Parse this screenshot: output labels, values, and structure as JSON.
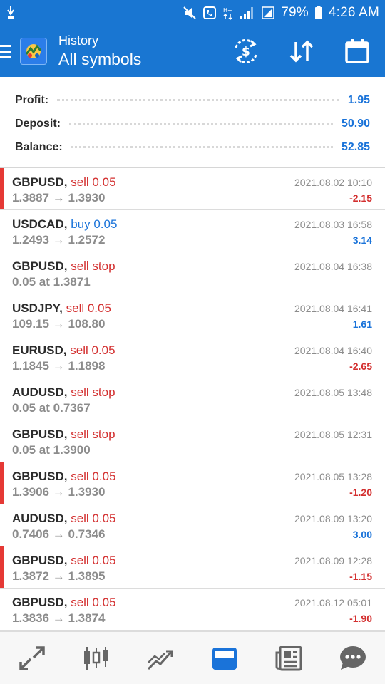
{
  "status_bar": {
    "battery": "79%",
    "time": "4:26 AM",
    "icons": [
      "notification-icon",
      "mute-icon",
      "phone-icon",
      "hplus-icon",
      "signal-icon",
      "battery-icon"
    ]
  },
  "app_bar": {
    "title": "History",
    "subtitle": "All symbols",
    "icons": [
      "menu-icon",
      "app-logo",
      "currency-exchange-icon",
      "sort-icon",
      "calendar-icon"
    ]
  },
  "summary": {
    "profit_label": "Profit:",
    "profit_value": "1.95",
    "deposit_label": "Deposit:",
    "deposit_value": "50.90",
    "balance_label": "Balance:",
    "balance_value": "52.85"
  },
  "trades": [
    {
      "symbol": "GBPUSD,",
      "action": "sell 0.05",
      "type": "sell",
      "detail": "1.3887 → 1.3930",
      "time": "2021.08.02 10:10",
      "profit": "-2.15",
      "marked": true
    },
    {
      "symbol": "USDCAD,",
      "action": "buy 0.05",
      "type": "buy",
      "detail": "1.2493 → 1.2572",
      "time": "2021.08.03 16:58",
      "profit": "3.14",
      "marked": false
    },
    {
      "symbol": "GBPUSD,",
      "action": "sell stop",
      "type": "sell",
      "detail": "0.05 at 1.3871",
      "time": "2021.08.04 16:38",
      "profit": "",
      "marked": false
    },
    {
      "symbol": "USDJPY,",
      "action": "sell 0.05",
      "type": "sell",
      "detail": "109.15 → 108.80",
      "time": "2021.08.04 16:41",
      "profit": "1.61",
      "marked": false
    },
    {
      "symbol": "EURUSD,",
      "action": "sell 0.05",
      "type": "sell",
      "detail": "1.1845 → 1.1898",
      "time": "2021.08.04 16:40",
      "profit": "-2.65",
      "marked": false
    },
    {
      "symbol": "AUDUSD,",
      "action": "sell stop",
      "type": "sell",
      "detail": "0.05 at 0.7367",
      "time": "2021.08.05 13:48",
      "profit": "",
      "marked": false
    },
    {
      "symbol": "GBPUSD,",
      "action": "sell stop",
      "type": "sell",
      "detail": "0.05 at 1.3900",
      "time": "2021.08.05 12:31",
      "profit": "",
      "marked": false
    },
    {
      "symbol": "GBPUSD,",
      "action": "sell 0.05",
      "type": "sell",
      "detail": "1.3906 → 1.3930",
      "time": "2021.08.05 13:28",
      "profit": "-1.20",
      "marked": true
    },
    {
      "symbol": "AUDUSD,",
      "action": "sell 0.05",
      "type": "sell",
      "detail": "0.7406 → 0.7346",
      "time": "2021.08.09 13:20",
      "profit": "3.00",
      "marked": false
    },
    {
      "symbol": "GBPUSD,",
      "action": "sell 0.05",
      "type": "sell",
      "detail": "1.3872 → 1.3895",
      "time": "2021.08.09 12:28",
      "profit": "-1.15",
      "marked": true
    },
    {
      "symbol": "GBPUSD,",
      "action": "sell 0.05",
      "type": "sell",
      "detail": "1.3836 → 1.3874",
      "time": "2021.08.12 05:01",
      "profit": "-1.90",
      "marked": false
    }
  ],
  "bottom_nav": {
    "items": [
      "quotes-icon",
      "chart-icon",
      "trade-icon",
      "history-icon",
      "news-icon",
      "chat-icon"
    ],
    "active": "history-icon"
  },
  "colors": {
    "primary": "#1976d2",
    "sell": "#d32f2f",
    "buy": "#1a73d9",
    "marker": "#e53935",
    "muted": "#8c8c8c"
  }
}
